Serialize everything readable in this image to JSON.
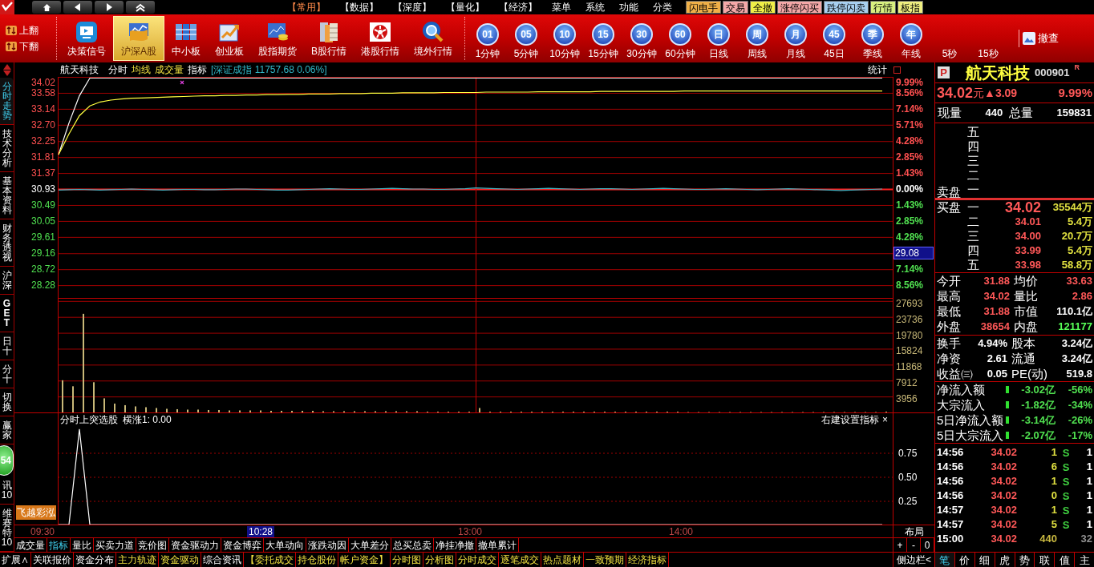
{
  "top_bar": {
    "menus": [
      {
        "label": "【常用】",
        "selected": true
      },
      {
        "label": "【数据】",
        "selected": false
      },
      {
        "label": "【深度】",
        "selected": false
      },
      {
        "label": "【量化】",
        "selected": false
      },
      {
        "label": "【经济】",
        "selected": false
      },
      {
        "label": "菜单",
        "selected": false
      },
      {
        "label": "系统",
        "selected": false
      },
      {
        "label": "功能",
        "selected": false
      },
      {
        "label": "分类",
        "selected": false
      }
    ],
    "quick_buttons": [
      {
        "label": "闪电手",
        "color": "#f0b048"
      },
      {
        "label": "交易",
        "color": "#f4a8a8"
      },
      {
        "label": "全撤",
        "color": "#f0f048"
      },
      {
        "label": "涨停闪买",
        "color": "#f4a8a8"
      },
      {
        "label": "跌停闪卖",
        "color": "#a8d0f0"
      },
      {
        "label": "行情",
        "color": "#d8f080"
      },
      {
        "label": "板指",
        "color": "#f0f080"
      }
    ]
  },
  "toolbar": {
    "paging": [
      "上翻",
      "下翻"
    ],
    "markets": [
      {
        "label": "决策信号",
        "selected": false
      },
      {
        "label": "沪深A股",
        "selected": true
      },
      {
        "label": "中小板",
        "selected": false
      },
      {
        "label": "创业板",
        "selected": false
      },
      {
        "label": "股指期货",
        "selected": false
      },
      {
        "label": "B股行情",
        "selected": false
      },
      {
        "label": "港股行情",
        "selected": false
      },
      {
        "label": "境外行情",
        "selected": false
      }
    ],
    "periods": [
      {
        "glyph": "01",
        "label": "1分钟"
      },
      {
        "glyph": "05",
        "label": "5分钟"
      },
      {
        "glyph": "10",
        "label": "10分钟"
      },
      {
        "glyph": "15",
        "label": "15分钟"
      },
      {
        "glyph": "30",
        "label": "30分钟"
      },
      {
        "glyph": "60",
        "label": "60分钟"
      },
      {
        "glyph": "日",
        "label": "日线"
      },
      {
        "glyph": "周",
        "label": "周线"
      },
      {
        "glyph": "月",
        "label": "月线"
      },
      {
        "glyph": "45",
        "label": "45日"
      },
      {
        "glyph": "季",
        "label": "季线"
      },
      {
        "glyph": "年",
        "label": "年线"
      },
      {
        "label": "5秒"
      },
      {
        "label": "15秒"
      }
    ],
    "recall": "撤查"
  },
  "side_tabs": [
    {
      "label": "分时走势",
      "selected": true
    },
    {
      "label": "技术分析",
      "selected": false
    },
    {
      "label": "基本资料",
      "selected": false
    },
    {
      "label": "财务透视",
      "selected": false
    },
    {
      "label": "沪深",
      "selected": false
    },
    {
      "label": "GET",
      "selected": false
    },
    {
      "label": "日十",
      "selected": false
    },
    {
      "label": "分十",
      "selected": false
    },
    {
      "label": "切换",
      "selected": false
    },
    {
      "label": "赢家",
      "selected": false
    },
    {
      "label": "讯10",
      "selected": false
    },
    {
      "label": "维赛特10",
      "selected": false
    }
  ],
  "float_badge": "54",
  "chart_header": {
    "stock": "航天科技",
    "legend": [
      {
        "label": "分时",
        "kind": "normal"
      },
      {
        "label": "均线",
        "kind": "highlight"
      },
      {
        "label": "成交量",
        "kind": "highlight"
      },
      {
        "label": "指标",
        "kind": "normal"
      }
    ],
    "index_quote": "[深证成指 11757.68 0.06%]",
    "stats_button": "统计"
  },
  "price_panel": {
    "right_labels": [
      {
        "text": "9.99%",
        "color": "#ff5050",
        "kind": "tick"
      },
      {
        "text": "8.56%",
        "color": "#ff5050",
        "kind": "tick"
      },
      {
        "text": "7.14%",
        "color": "#ff5050",
        "kind": "tick"
      },
      {
        "text": "5.71%",
        "color": "#ff5050",
        "kind": "tick"
      },
      {
        "text": "4.28%",
        "color": "#ff5050",
        "kind": "tick"
      },
      {
        "text": "2.85%",
        "color": "#ff5050",
        "kind": "tick"
      },
      {
        "text": "1.43%",
        "color": "#ff5050",
        "kind": "tick"
      },
      {
        "text": "0.00%",
        "color": "#ffffff",
        "kind": "tick"
      },
      {
        "text": "1.43%",
        "color": "#50e050",
        "kind": "tick"
      },
      {
        "text": "2.85%",
        "color": "#50e050",
        "kind": "tick"
      },
      {
        "text": "4.28%",
        "color": "#50e050",
        "kind": "tick"
      },
      {
        "text": "29.08",
        "kind": "cursor"
      },
      {
        "text": "7.14%",
        "color": "#50e050",
        "kind": "tick"
      },
      {
        "text": "8.56%",
        "color": "#50e050",
        "kind": "tick"
      }
    ],
    "chart_data": {
      "type": "line",
      "ylim": [
        27.93,
        34.02
      ],
      "yticks": [
        {
          "value": 34.02,
          "label": "34.02"
        },
        {
          "value": 33.58,
          "label": "33.58"
        },
        {
          "value": 33.14,
          "label": "33.14"
        },
        {
          "value": 32.7,
          "label": "32.70"
        },
        {
          "value": 32.25,
          "label": "32.25"
        },
        {
          "value": 31.81,
          "label": "31.81"
        },
        {
          "value": 31.37,
          "label": "31.37"
        },
        {
          "value": 30.93,
          "label": "30.93"
        },
        {
          "value": 30.49,
          "label": "30.49"
        },
        {
          "value": 30.05,
          "label": "30.05"
        },
        {
          "value": 29.61,
          "label": "29.61"
        },
        {
          "value": 29.16,
          "label": "29.16"
        },
        {
          "value": 28.72,
          "label": "28.72"
        },
        {
          "value": 28.28,
          "label": "28.28"
        }
      ],
      "grid": true,
      "ref_lines": [
        {
          "axis": "y",
          "value": 30.93,
          "color": "#ff2020"
        }
      ],
      "series": [
        {
          "color": "#ffffff",
          "values": [
            31.88,
            32.75,
            33.5,
            34.02,
            34.02,
            34.02,
            34.02,
            34.02,
            34.02,
            34.02,
            34.02,
            34.02,
            34.02,
            34.02,
            34.02,
            34.02,
            34.02,
            34.02,
            34.02,
            34.02,
            34.02,
            34.02,
            34.02,
            34.02,
            34.02,
            34.02,
            34.02,
            34.02,
            34.02,
            34.02,
            34.02,
            34.02,
            34.02,
            34.02,
            34.02,
            34.02,
            34.02,
            34.02,
            34.02,
            34.02,
            34.02,
            34.02,
            34.02,
            34.02,
            34.02,
            34.02,
            34.02,
            34.02,
            34.02,
            34.02,
            34.02,
            34.02,
            34.02,
            34.02,
            34.02,
            34.02,
            34.02,
            34.02,
            34.02,
            34.02,
            34.02,
            34.02,
            34.02,
            34.02,
            34.02,
            34.02,
            34.02,
            34.02,
            34.02,
            34.02,
            34.02,
            34.02,
            34.02,
            34.02,
            34.02,
            34.02,
            34.02,
            34.02,
            34.02,
            34.02
          ]
        },
        {
          "color": "#ffff40",
          "values": [
            31.88,
            32.45,
            32.95,
            33.22,
            33.33,
            33.38,
            33.41,
            33.43,
            33.44,
            33.45,
            33.46,
            33.47,
            33.48,
            33.49,
            33.5,
            33.5,
            33.51,
            33.51,
            33.52,
            33.52,
            33.53,
            33.53,
            33.54,
            33.54,
            33.55,
            33.55,
            33.55,
            33.56,
            33.56,
            33.56,
            33.57,
            33.57,
            33.57,
            33.58,
            33.58,
            33.58,
            33.58,
            33.59,
            33.59,
            33.59,
            33.59,
            33.6,
            33.6,
            33.6,
            33.6,
            33.6,
            33.61,
            33.61,
            33.61,
            33.61,
            33.61,
            33.61,
            33.62,
            33.62,
            33.62,
            33.62,
            33.62,
            33.62,
            33.62,
            33.62,
            33.63,
            33.63,
            33.63,
            33.63,
            33.63,
            33.63,
            33.63,
            33.63,
            33.63,
            33.63,
            33.63,
            33.63,
            33.63,
            33.63,
            33.63,
            33.63,
            33.63,
            33.63,
            33.63,
            33.63
          ]
        },
        {
          "color": "#40b0c0",
          "values": [
            30.9,
            30.91,
            30.92,
            30.91,
            30.9,
            30.91,
            30.92,
            30.93,
            30.92,
            30.91,
            30.9,
            30.91,
            30.92,
            30.92,
            30.91,
            30.91,
            30.92,
            30.93,
            30.93,
            30.92,
            30.91,
            30.9,
            30.9,
            30.91,
            30.92,
            30.93,
            30.94,
            30.93,
            30.92,
            30.92,
            30.93,
            30.94,
            30.95,
            30.94,
            30.93,
            30.93,
            30.92,
            30.92,
            30.93,
            30.94,
            30.96,
            30.95,
            30.94,
            30.93,
            30.92,
            30.93,
            30.94,
            30.95,
            30.94,
            30.93,
            30.92,
            30.93,
            30.94,
            30.94,
            30.93,
            30.92,
            30.93,
            30.94,
            30.95,
            30.94,
            30.93,
            30.92,
            30.92,
            30.93,
            30.94,
            30.93,
            30.92,
            30.91,
            30.92,
            30.93,
            30.94,
            30.93,
            30.92,
            30.91,
            30.9,
            30.89,
            30.9,
            30.91,
            30.92,
            30.93
          ]
        }
      ]
    }
  },
  "volume_panel": {
    "chart_data": {
      "type": "bar",
      "ylim": [
        0,
        28452
      ],
      "yticks": [
        {
          "value": 27693,
          "label": "27693"
        },
        {
          "value": 23736,
          "label": "23736"
        },
        {
          "value": 19780,
          "label": "19780"
        },
        {
          "value": 15824,
          "label": "15824"
        },
        {
          "value": 11868,
          "label": "11868"
        },
        {
          "value": 7912,
          "label": "7912"
        },
        {
          "value": 3956,
          "label": "3956"
        }
      ],
      "grid": true,
      "values": [
        8000,
        6500,
        24500,
        7500,
        3500,
        2200,
        1800,
        1500,
        1300,
        1100,
        900,
        800,
        700,
        700,
        600,
        600,
        500,
        500,
        500,
        500,
        400,
        400,
        400,
        400,
        400,
        300,
        300,
        300,
        300,
        300,
        300,
        300,
        300,
        300,
        300,
        200,
        200,
        200,
        200,
        200,
        1100,
        200,
        200,
        200,
        200,
        200,
        200,
        200,
        200,
        200,
        200,
        200,
        200,
        200,
        200,
        200,
        200,
        200,
        200,
        200,
        100,
        100,
        100,
        100,
        100,
        100,
        100,
        100,
        100,
        100,
        100,
        100,
        100,
        100,
        100,
        100,
        100,
        100,
        100,
        200
      ]
    }
  },
  "indicator_panel": {
    "title": "分时上突选股",
    "reading": "横涨1: 0.00",
    "settings": "右建设置指标",
    "close": "×",
    "badge": "飞越彩泓",
    "chart_data": {
      "type": "line",
      "grid": true,
      "ylim": [
        0,
        1.1667
      ],
      "yticks": [
        {
          "value": 0.75,
          "label": "0.75"
        },
        {
          "value": 0.5,
          "label": "0.50"
        },
        {
          "value": 0.25,
          "label": "0.25"
        }
      ],
      "series": [
        {
          "color": "#ffffff",
          "values": [
            0,
            0,
            1,
            0,
            0,
            0,
            0,
            0,
            0,
            0,
            0,
            0,
            0,
            0,
            0,
            0,
            0,
            0,
            0,
            0,
            0,
            0,
            0,
            0,
            0,
            0,
            0,
            0,
            0,
            0,
            0,
            0,
            0,
            0,
            0,
            0,
            0,
            0,
            0,
            0,
            0,
            0,
            0,
            0,
            0,
            0,
            0,
            0,
            0,
            0,
            0,
            0,
            0,
            0,
            0,
            0,
            0,
            0,
            0,
            0,
            0,
            0,
            0,
            0,
            0,
            0,
            0,
            0,
            0,
            0,
            0,
            0,
            0,
            0,
            0,
            0,
            0,
            0,
            0,
            0
          ]
        }
      ]
    }
  },
  "time_axis": [
    {
      "label": "09:30",
      "selected": false
    },
    {
      "label": "10:28",
      "selected": true
    },
    {
      "label": "13:00",
      "selected": false
    },
    {
      "label": "14:00",
      "selected": false
    }
  ],
  "layout_button": "布局",
  "chart_tabs": [
    {
      "label": "成交量",
      "selected": false
    },
    {
      "label": "指标",
      "selected": true
    },
    {
      "label": "量比",
      "selected": false
    },
    {
      "label": "买卖力道",
      "selected": false
    },
    {
      "label": "竞价图",
      "selected": false
    },
    {
      "label": "资金驱动力",
      "selected": false
    },
    {
      "label": "资金博弈",
      "selected": false
    },
    {
      "label": "大单动向",
      "selected": false
    },
    {
      "label": "涨跌动因",
      "selected": false
    },
    {
      "label": "大单差分",
      "selected": false
    },
    {
      "label": "总买总卖",
      "selected": false
    },
    {
      "label": "净挂净撤",
      "selected": false
    },
    {
      "label": "撤单累计",
      "selected": false
    }
  ],
  "zoom_buttons": [
    "+",
    "-",
    "0"
  ],
  "bottom_bar": {
    "items": [
      {
        "label": "扩展∧",
        "kind": "normal"
      },
      {
        "label": "关联报价",
        "kind": "normal"
      },
      {
        "label": "资金分布",
        "kind": "normal"
      },
      {
        "label": "主力轨迹",
        "kind": "highlight"
      },
      {
        "label": "资金驱动",
        "kind": "highlight"
      },
      {
        "label": "综合资讯",
        "kind": "normal"
      },
      {
        "label": "【委托成交",
        "kind": "highlight"
      },
      {
        "label": "持仓股份",
        "kind": "highlight"
      },
      {
        "label": "帐户资金】",
        "kind": "highlight"
      },
      {
        "label": "分时图",
        "kind": "highlight"
      },
      {
        "label": "分析图",
        "kind": "highlight"
      },
      {
        "label": "分时成交",
        "kind": "highlight"
      },
      {
        "label": "逐笔成交",
        "kind": "highlight"
      },
      {
        "label": "热点题材",
        "kind": "highlight"
      },
      {
        "label": "一致预期",
        "kind": "highlight"
      },
      {
        "label": "经济指标",
        "kind": "highlight"
      }
    ],
    "sidebar_toggle": "侧边栏<",
    "side_tabs": [
      {
        "label": "笔",
        "selected": true
      },
      {
        "label": "价",
        "selected": false
      },
      {
        "label": "细",
        "selected": false
      },
      {
        "label": "虎",
        "selected": false
      },
      {
        "label": "势",
        "selected": false
      },
      {
        "label": "联",
        "selected": false
      },
      {
        "label": "值",
        "selected": false
      },
      {
        "label": "主",
        "selected": false
      }
    ]
  },
  "quote": {
    "flag": "P",
    "name": "航天科技",
    "code": "000901",
    "mark": "R",
    "price": "34.02",
    "unit": "元",
    "change": "▲3.09",
    "percent": "9.99%",
    "now_label": "现量",
    "now_value": "440",
    "total_label": "总量",
    "total_value": "159831"
  },
  "order_book": {
    "ask_title": "卖盘",
    "bid_title": "买盘",
    "asks": [
      "五",
      "四",
      "三",
      "二",
      "一"
    ],
    "bids": [
      {
        "level": "一",
        "price": "34.02",
        "volume": "35544万"
      },
      {
        "level": "二",
        "price": "34.01",
        "volume": "5.4万"
      },
      {
        "level": "三",
        "price": "34.00",
        "volume": "20.7万"
      },
      {
        "level": "四",
        "price": "33.99",
        "volume": "5.4万"
      },
      {
        "level": "五",
        "price": "33.98",
        "volume": "58.8万"
      }
    ]
  },
  "stats": [
    {
      "label": "今开",
      "value": "31.88",
      "color": "#ff5858"
    },
    {
      "label": "均价",
      "value": "33.63",
      "color": "#ff5858"
    },
    {
      "label": "最高",
      "value": "34.02",
      "color": "#ff5858"
    },
    {
      "label": "量比",
      "value": "2.86",
      "color": "#ff5858"
    },
    {
      "label": "最低",
      "value": "31.88",
      "color": "#ff5858"
    },
    {
      "label": "市值",
      "value": "110.1亿",
      "color": "#ffffff"
    },
    {
      "label": "外盘",
      "value": "38654",
      "color": "#ff5858"
    },
    {
      "label": "内盘",
      "value": "121177",
      "color": "#58ff58"
    }
  ],
  "fundamentals": [
    {
      "label": "换手",
      "value": "4.94%",
      "label2": "股本",
      "value2": "3.24亿"
    },
    {
      "label": "净资",
      "value": "2.61",
      "label2": "流通",
      "value2": "3.24亿"
    },
    {
      "label": "收益㈢",
      "value": "0.05",
      "label2": "PE(动)",
      "value2": "519.8"
    }
  ],
  "flows": [
    {
      "label": "净流入额",
      "amount": "-3.02亿",
      "percent": "-56%"
    },
    {
      "label": "大宗流入",
      "amount": "-1.82亿",
      "percent": "-34%"
    },
    {
      "label": "5日净流入额",
      "amount": "-3.14亿",
      "percent": "-26%"
    },
    {
      "label": "5日大宗流入",
      "amount": "-2.07亿",
      "percent": "-17%"
    }
  ],
  "trades": [
    {
      "kind": "trade",
      "time": "14:56",
      "price": "34.02",
      "volume": "1",
      "side": "S",
      "count": "1"
    },
    {
      "kind": "trade",
      "time": "14:56",
      "price": "34.02",
      "volume": "6",
      "side": "S",
      "count": "1"
    },
    {
      "kind": "trade",
      "time": "14:56",
      "price": "34.02",
      "volume": "1",
      "side": "S",
      "count": "1"
    },
    {
      "kind": "trade",
      "time": "14:56",
      "price": "34.02",
      "volume": "0",
      "side": "S",
      "count": "1"
    },
    {
      "kind": "trade",
      "time": "14:57",
      "price": "34.02",
      "volume": "1",
      "side": "S",
      "count": "1"
    },
    {
      "kind": "trade",
      "time": "14:57",
      "price": "34.02",
      "volume": "5",
      "side": "S",
      "count": "1"
    },
    {
      "kind": "close",
      "time": "15:00",
      "price": "34.02",
      "volume": "440",
      "count": "32"
    }
  ]
}
